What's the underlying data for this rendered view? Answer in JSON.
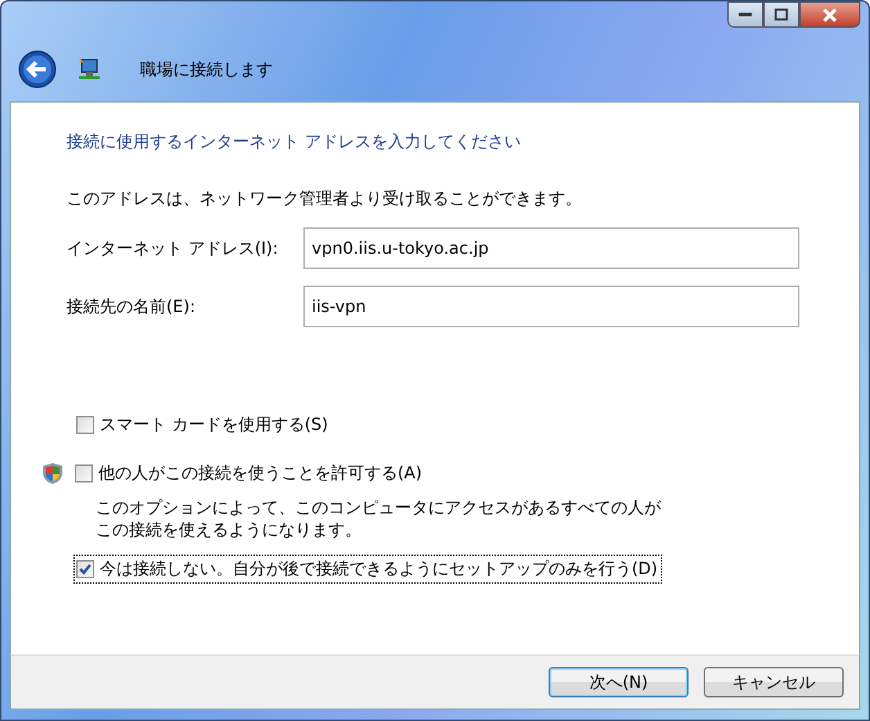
{
  "window": {
    "title": "職場に接続します"
  },
  "heading": "接続に使用するインターネット アドレスを入力してください",
  "description": "このアドレスは、ネットワーク管理者より受け取ることができます。",
  "fields": [
    {
      "label": "インターネット アドレス(I):",
      "value": "vpn0.iis.u-tokyo.ac.jp"
    },
    {
      "label": "接続先の名前(E):",
      "value": "iis-vpn"
    }
  ],
  "options": [
    {
      "label": "スマート カードを使用する(S)",
      "checked": false,
      "shield": false,
      "focused": false
    },
    {
      "label": "他の人がこの接続を使うことを許可する(A)",
      "checked": false,
      "shield": true,
      "focused": false,
      "note": [
        "このオプションによって、このコンピュータにアクセスがあるすべての人が",
        "この接続を使えるようになります。"
      ]
    },
    {
      "label": "今は接続しない。自分が後で接続できるようにセットアップのみを行う(D)",
      "checked": true,
      "shield": false,
      "focused": true
    }
  ],
  "buttons": [
    {
      "label": "次へ(N)",
      "default": true
    },
    {
      "label": "キャンセル",
      "default": false
    }
  ]
}
